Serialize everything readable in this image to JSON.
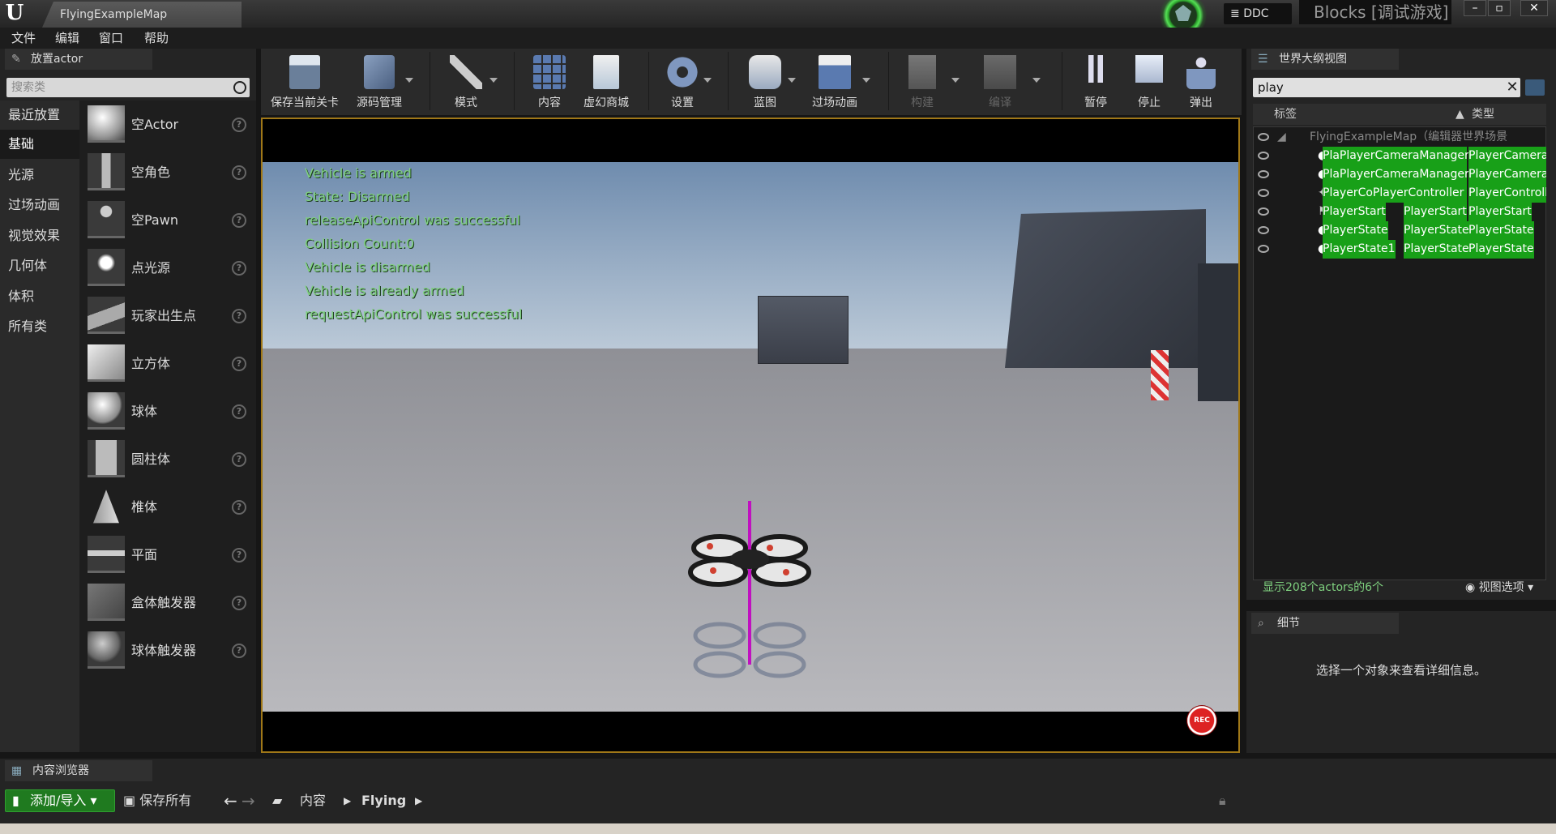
{
  "window": {
    "tab_title": "FlyingExampleMap",
    "app_title": "Blocks [调试游戏]",
    "ddc_label": "DDC"
  },
  "menu": [
    "文件",
    "编辑",
    "窗口",
    "帮助"
  ],
  "place_panel": {
    "tab_label": "放置actor",
    "search_placeholder": "搜索类",
    "categories": [
      "最近放置",
      "基础",
      "光源",
      "过场动画",
      "视觉效果",
      "几何体",
      "体积",
      "所有类"
    ],
    "selected_category": "基础",
    "items": [
      "空Actor",
      "空角色",
      "空Pawn",
      "点光源",
      "玩家出生点",
      "立方体",
      "球体",
      "圆柱体",
      "椎体",
      "平面",
      "盒体触发器",
      "球体触发器"
    ],
    "help_glyph": "?"
  },
  "toolbar": {
    "buttons": [
      "保存当前关卡",
      "源码管理",
      "模式",
      "内容",
      "虚幻商城",
      "设置",
      "蓝图",
      "过场动画",
      "构建",
      "编译",
      "暂停",
      "停止",
      "弹出"
    ]
  },
  "viewport": {
    "debug_messages": [
      "Vehicle is armed",
      "State: Disarmed",
      "releaseApiControl was successful",
      "Collision Count:0",
      "Vehicle is disarmed",
      "Vehicle is already armed",
      "requestApiControl was successful"
    ],
    "rec_label": "REC"
  },
  "outliner": {
    "tab_label": "世界大纲视图",
    "search_value": "play",
    "col_label": "标签",
    "col_type": "类型",
    "root_label": "FlyingExampleMap（编辑器世界场景",
    "rows": [
      {
        "label": "PlaPlayerCameraManager",
        "type": "PlayerCameral"
      },
      {
        "label": "PlaPlayerCameraManager",
        "type": "PlayerCameral"
      },
      {
        "label": "PlayerCoPlayerController",
        "type": "PlayerControll"
      },
      {
        "label": "PlayerStart",
        "mid": "PlayerStart",
        "type": "PlayerStart"
      },
      {
        "label": "PlayerState",
        "mid": "PlayerState",
        "type": "PlayerState"
      },
      {
        "label": "PlayerState1",
        "mid": "PlayerState",
        "type": "PlayerState"
      }
    ],
    "footer_count": "显示208个actors的6个",
    "view_options": "视图选项"
  },
  "details": {
    "tab_label": "细节",
    "message": "选择一个对象来查看详细信息。"
  },
  "content_browser": {
    "tab_label": "内容浏览器",
    "add_import": "添加/导入",
    "save_all": "保存所有",
    "path": [
      "内容",
      "Flying"
    ]
  },
  "colors": {
    "accent": "#a07818",
    "highlight": "#18a018",
    "debug_text": "#7fd17f"
  }
}
